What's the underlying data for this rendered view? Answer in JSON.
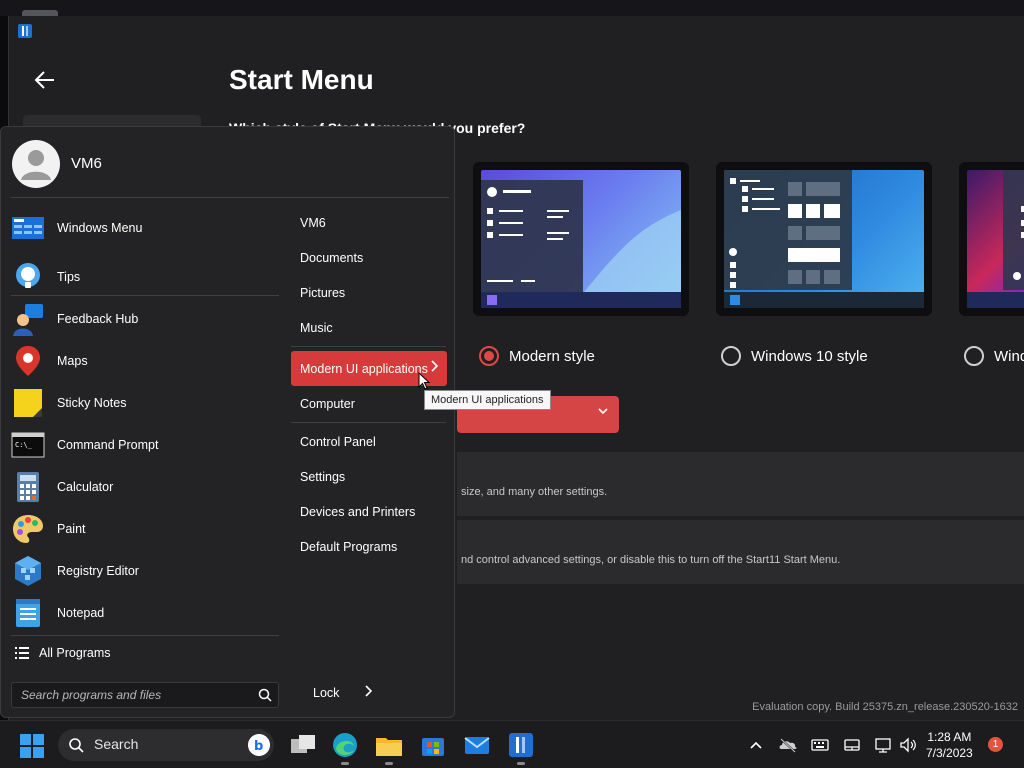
{
  "settings_window": {
    "title": "Start Menu",
    "question": "Which style of Start Menu would you prefer?",
    "styles": [
      {
        "label": "Modern style",
        "selected": true
      },
      {
        "label": "Windows 10 style",
        "selected": false
      },
      {
        "label": "Wind",
        "selected": false
      }
    ],
    "panel_1_text": "size, and many other settings.",
    "panel_2_text": "nd control advanced settings, or disable this to turn off the Start11 Start Menu.",
    "evaluation_text": "Evaluation copy. Build 25375.zn_release.230520-1632",
    "accent_color": "#d64545"
  },
  "start_menu": {
    "user_name": "VM6",
    "apps": [
      {
        "label": "Windows Menu",
        "icon": "windows-menu-icon"
      },
      {
        "label": "Tips",
        "icon": "tips-icon"
      },
      {
        "label": "Feedback Hub",
        "icon": "feedback-hub-icon"
      },
      {
        "label": "Maps",
        "icon": "maps-icon"
      },
      {
        "label": "Sticky Notes",
        "icon": "sticky-notes-icon"
      },
      {
        "label": "Command Prompt",
        "icon": "command-prompt-icon"
      },
      {
        "label": "Calculator",
        "icon": "calculator-icon"
      },
      {
        "label": "Paint",
        "icon": "paint-icon"
      },
      {
        "label": "Registry Editor",
        "icon": "registry-editor-icon"
      },
      {
        "label": "Notepad",
        "icon": "notepad-icon"
      }
    ],
    "all_programs": "All Programs",
    "search_placeholder": "Search programs and files",
    "places": [
      "VM6",
      "Documents",
      "Pictures",
      "Music",
      "Modern UI applications",
      "Computer",
      "Control Panel",
      "Settings",
      "Devices and Printers",
      "Default Programs"
    ],
    "active_place": "Modern UI applications",
    "tooltip": "Modern UI applications",
    "lock_label": "Lock"
  },
  "taskbar": {
    "search_label": "Search",
    "time": "1:28 AM",
    "date": "7/3/2023",
    "notification_count": "1"
  }
}
